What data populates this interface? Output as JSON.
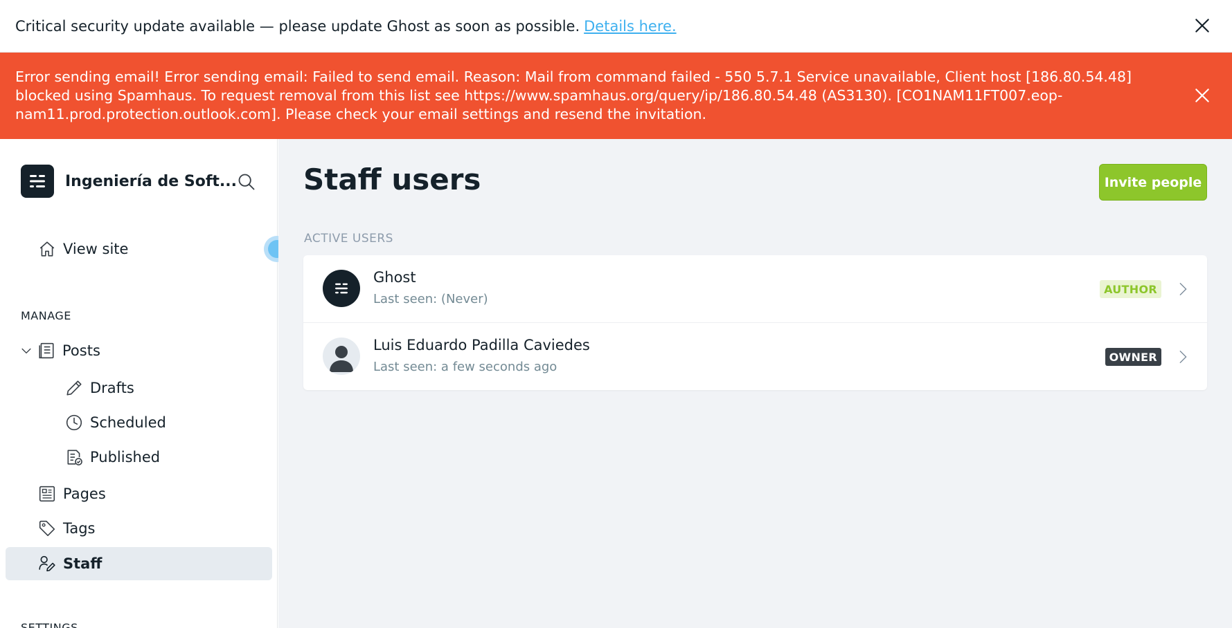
{
  "top_banner": {
    "text": "Critical security update available — please update Ghost as soon as possible.",
    "link_text": "Details here."
  },
  "error_banner": {
    "text": "Error sending email! Error sending email: Failed to send email. Reason: Mail from command failed - 550 5.7.1 Service unavailable, Client host [186.80.54.48] blocked using Spamhaus. To request removal from this list see https://www.spamhaus.org/query/ip/186.80.54.48 (AS3130). [CO1NAM11FT007.eop-nam11.prod.protection.outlook.com]. Please check your email settings and resend the invitation."
  },
  "sidebar": {
    "site_name": "Ingeniería de Soft...",
    "view_site": "View site",
    "manage_title": "MANAGE",
    "settings_title": "SETTINGS",
    "items": [
      {
        "label": "Posts",
        "icon": "posts-icon"
      },
      {
        "label": "Drafts",
        "icon": "pencil-icon"
      },
      {
        "label": "Scheduled",
        "icon": "clock-icon"
      },
      {
        "label": "Published",
        "icon": "published-icon"
      },
      {
        "label": "Pages",
        "icon": "pages-icon"
      },
      {
        "label": "Tags",
        "icon": "tag-icon"
      },
      {
        "label": "Staff",
        "icon": "staff-icon"
      }
    ]
  },
  "main": {
    "title": "Staff users",
    "invite_button": "Invite people",
    "active_users_label": "ACTIVE USERS",
    "users": [
      {
        "name": "Ghost",
        "last_seen": "Last seen: (Never)",
        "role": "AUTHOR"
      },
      {
        "name": "Luis Eduardo Padilla Caviedes",
        "last_seen": "Last seen: a few seconds ago",
        "role": "OWNER"
      }
    ]
  },
  "colors": {
    "error_banner": "#f05230",
    "accent_green": "#8dc62b",
    "link_blue": "#3eb0ef",
    "owner_badge": "#394047"
  }
}
